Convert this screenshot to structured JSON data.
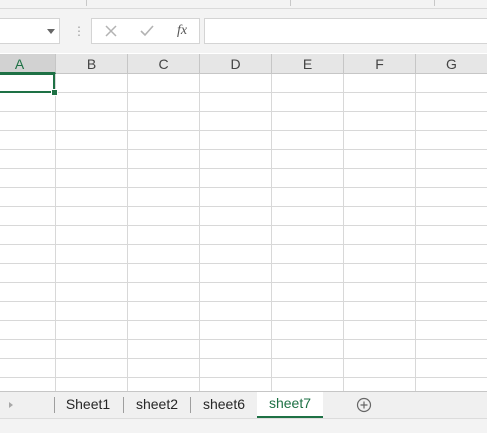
{
  "formula_bar": {
    "name_box_value": "",
    "fx_label": "fx",
    "formula_value": ""
  },
  "columns": [
    "A",
    "B",
    "C",
    "D",
    "E",
    "F",
    "G"
  ],
  "active_column": "A",
  "sheet_tabs": [
    "Sheet1",
    "sheet2",
    "sheet6",
    "sheet7"
  ],
  "active_sheet": "sheet7",
  "icons": {
    "cancel": "close-icon",
    "enter": "check-icon",
    "function": "fx-icon",
    "add_sheet": "plus-circle-icon",
    "name_box_dropdown": "chevron-down-icon"
  },
  "colors": {
    "accent": "#1e7145",
    "gridline": "#d8d8d8",
    "header_bg": "#e6e6e6",
    "toolbar_bg": "#f3f3f3"
  }
}
